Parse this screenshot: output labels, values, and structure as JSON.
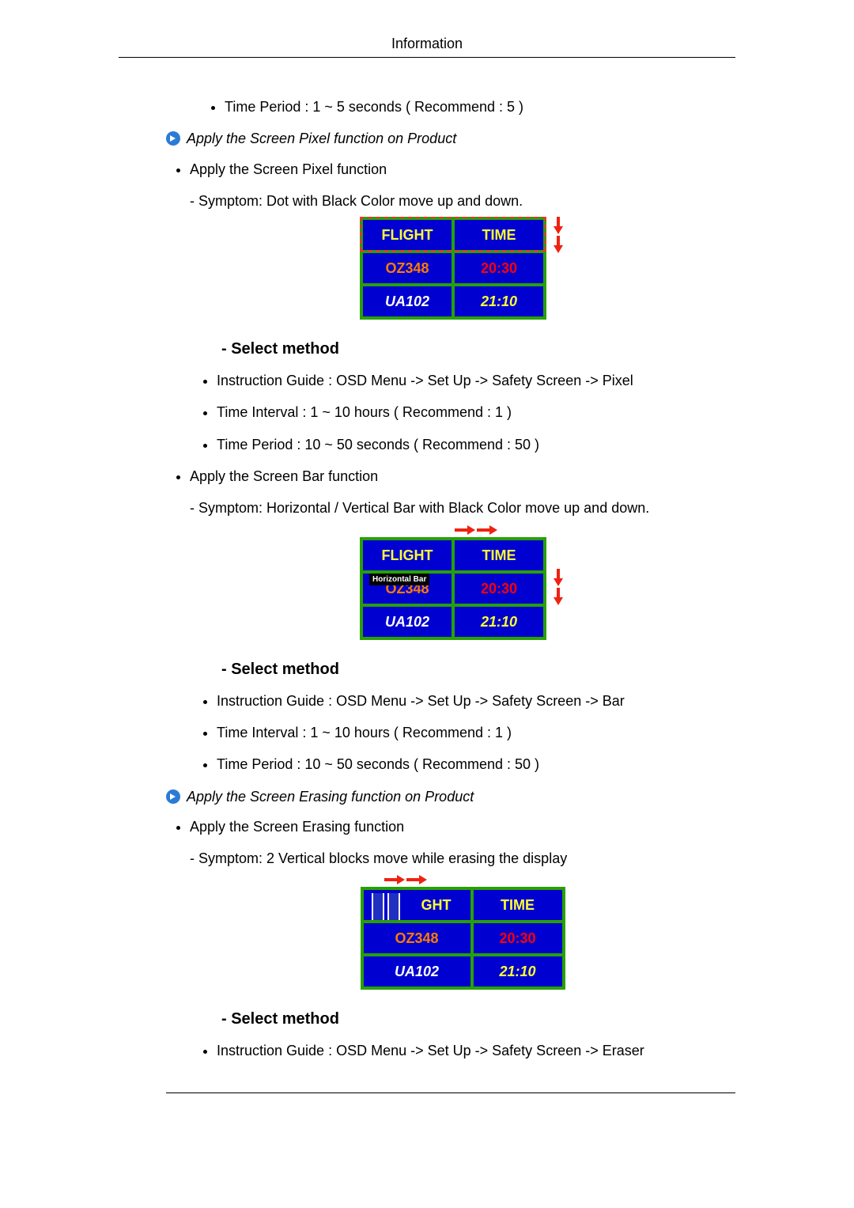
{
  "header": {
    "title": "Information"
  },
  "intro": {
    "time_period": "Time Period : 1 ~ 5 seconds ( Recommend : 5 )"
  },
  "pixel": {
    "section_title": "Apply the Screen Pixel function on Product",
    "apply_label": "Apply the Screen Pixel function",
    "symptom": "- Symptom: Dot with Black Color move up and down.",
    "select_method": "- Select method",
    "instruction": "Instruction Guide : OSD Menu -> Set Up -> Safety Screen -> Pixel",
    "time_interval": "Time Interval : 1 ~ 10 hours ( Recommend : 1 )",
    "time_period": "Time Period : 10 ~ 50 seconds ( Recommend : 50 )"
  },
  "bar": {
    "apply_label": "Apply the Screen Bar function",
    "symptom": "- Symptom: Horizontal / Vertical Bar with Black Color move up and down.",
    "hbar_label": "Horizontal Bar",
    "select_method": "- Select method",
    "instruction": "Instruction Guide : OSD Menu -> Set Up -> Safety Screen -> Bar",
    "time_interval": "Time Interval : 1 ~ 10 hours ( Recommend : 1 )",
    "time_period": "Time Period : 10 ~ 50 seconds ( Recommend : 50 )"
  },
  "erase": {
    "section_title": "Apply the Screen Erasing function on Product",
    "apply_label": "Apply the Screen Erasing function",
    "symptom": "- Symptom: 2 Vertical blocks move while erasing the display",
    "select_method": "- Select method",
    "instruction": "Instruction Guide : OSD Menu -> Set Up -> Safety Screen -> Eraser"
  },
  "board": {
    "header_flight": "FLIGHT",
    "header_time": "TIME",
    "row1_flight": "OZ348",
    "row1_time": "20:30",
    "row2_flight": "UA102",
    "row2_time": "21:10",
    "erase_header_flight": "GHT"
  }
}
